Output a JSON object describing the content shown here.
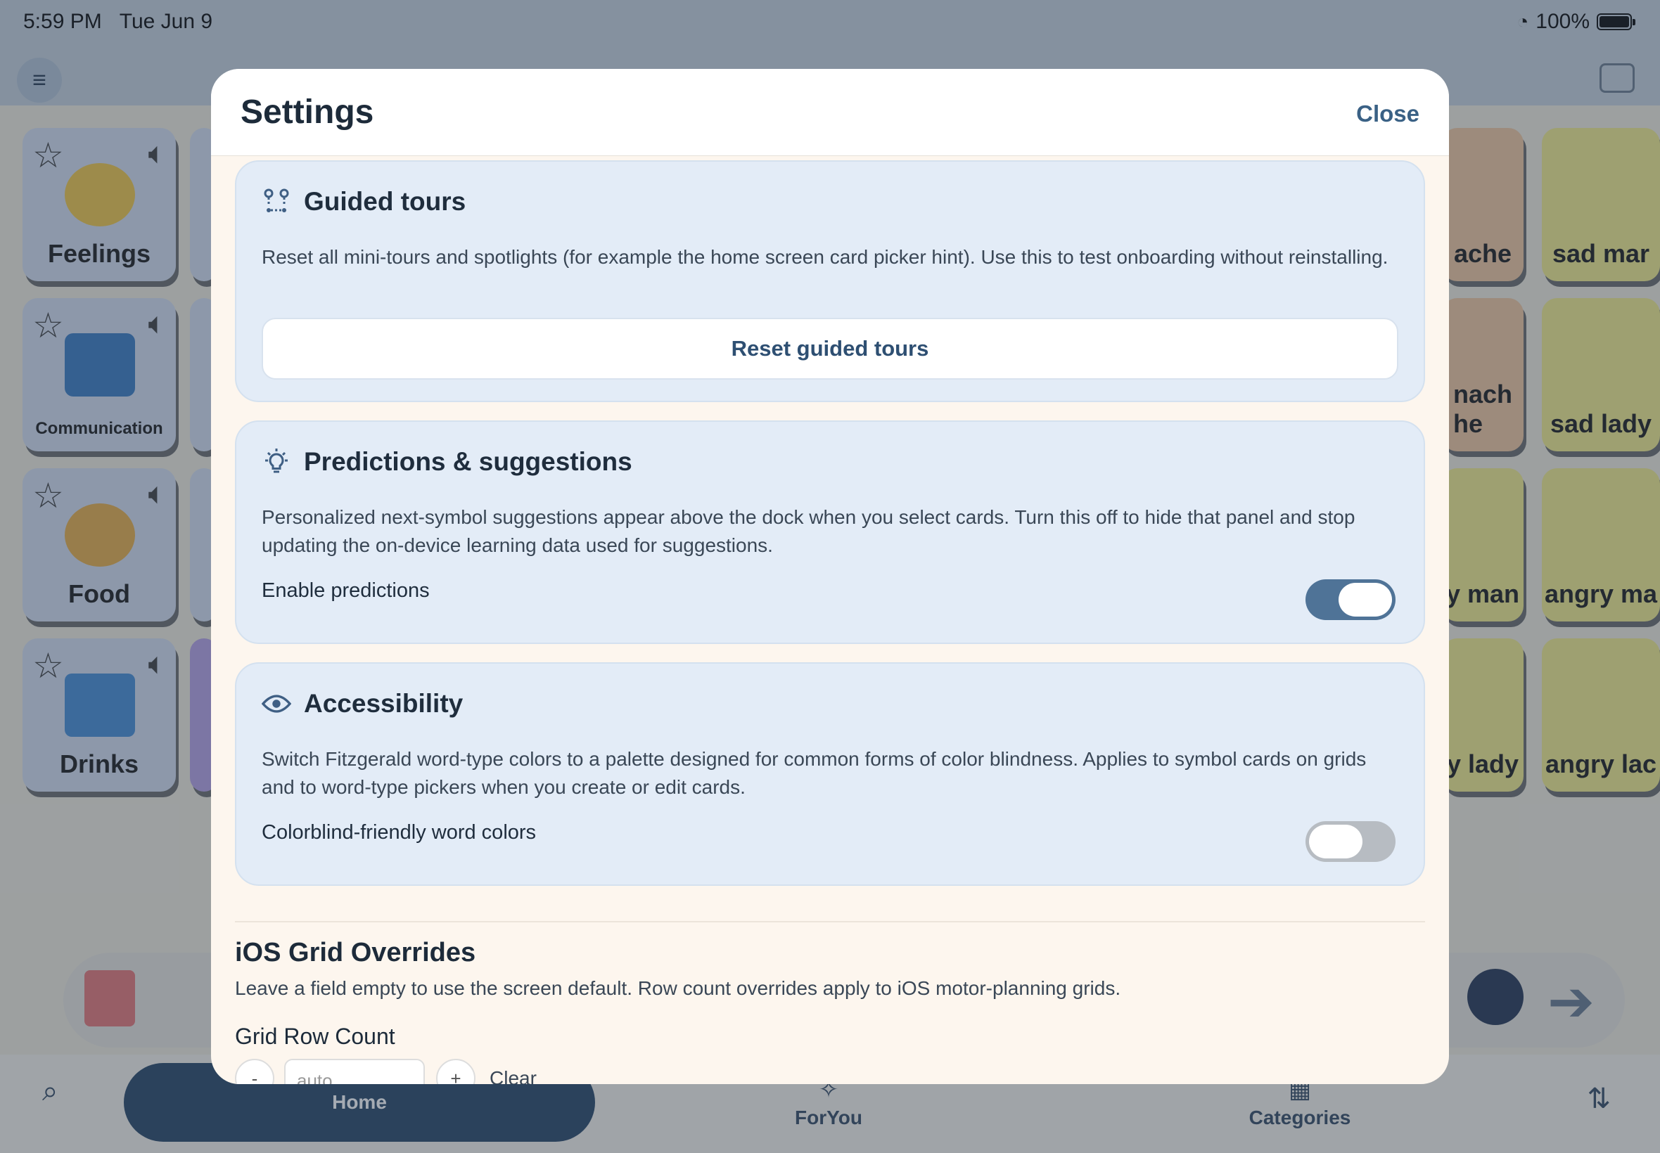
{
  "status": {
    "time": "5:59 PM",
    "date": "Tue Jun 9",
    "battery": "100%"
  },
  "cards_left": [
    {
      "label": "Feelings",
      "color": "#d6dff0"
    },
    {
      "label": "Communication",
      "color": "#d6dff0"
    },
    {
      "label": "Food",
      "color": "#d6dff0"
    },
    {
      "label": "Drinks",
      "color": "#d6dff0"
    }
  ],
  "cards_right_a": [
    "ache",
    "nach\nhe",
    "y man",
    "y lady"
  ],
  "cards_right_b": [
    "sad mar",
    "sad lady",
    "angry ma",
    "angry lac"
  ],
  "tabs": {
    "home": "Home",
    "foryou": "ForYou",
    "categories": "Categories"
  },
  "modal": {
    "title": "Settings",
    "close_label": "Close",
    "guided": {
      "title": "Guided tours",
      "description": "Reset all mini-tours and spotlights (for example the home screen card picker hint). Use this to test onboarding without reinstalling.",
      "button": "Reset guided tours"
    },
    "predictions": {
      "title": "Predictions & suggestions",
      "description": "Personalized next-symbol suggestions appear above the dock when you select cards. Turn this off to hide that panel and stop updating the on-device learning data used for suggestions.",
      "toggle_label": "Enable predictions",
      "enabled": true
    },
    "accessibility": {
      "title": "Accessibility",
      "description": "Switch Fitzgerald word-type colors to a palette designed for common forms of color blindness. Applies to symbol cards on grids and to word-type pickers when you create or edit cards.",
      "toggle_label": "Colorblind-friendly word colors",
      "enabled": false
    },
    "grid": {
      "title": "iOS Grid Overrides",
      "description": "Leave a field empty to use the screen default. Row count overrides apply to iOS motor-planning grids.",
      "row_label": "Grid Row Count",
      "minus": "-",
      "plus": "+",
      "placeholder": "auto",
      "clear": "Clear"
    }
  },
  "colors": {
    "accent": "#3a6185",
    "toggle_on": "#4f7397",
    "section_bg": "#e3ecf7"
  }
}
